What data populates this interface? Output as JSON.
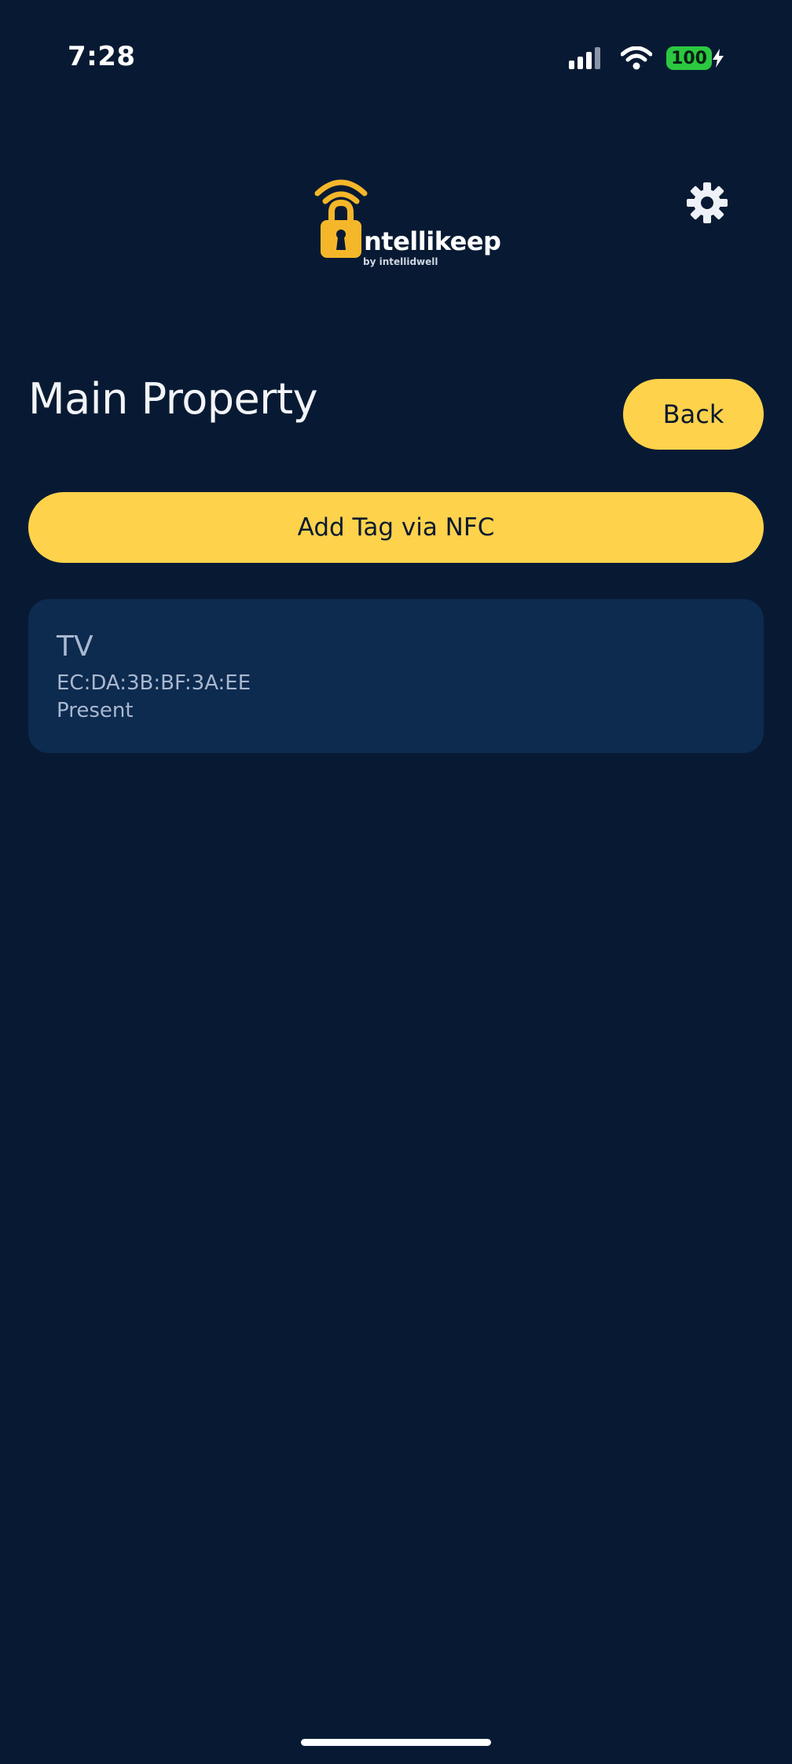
{
  "status_bar": {
    "time": "7:28",
    "battery_level": "100",
    "signal_icon": "cellular-signal-icon",
    "wifi_icon": "wifi-icon",
    "charging_icon": "charging-bolt-icon"
  },
  "header": {
    "logo_word": "ntellikeep",
    "logo_sub": "by intellidwell",
    "settings_icon": "gear-icon"
  },
  "page": {
    "title": "Main Property",
    "back_label": "Back",
    "add_tag_label": "Add Tag via NFC"
  },
  "tags": [
    {
      "name": "TV",
      "mac": "EC:DA:3B:BF:3A:EE",
      "status": "Present"
    }
  ],
  "colors": {
    "background": "#081a33",
    "accent": "#ffd24c",
    "card": "#0d2a4f",
    "card_text": "#a9b8cf",
    "logo_gold": "#f5b72a",
    "battery": "#2bc840"
  }
}
